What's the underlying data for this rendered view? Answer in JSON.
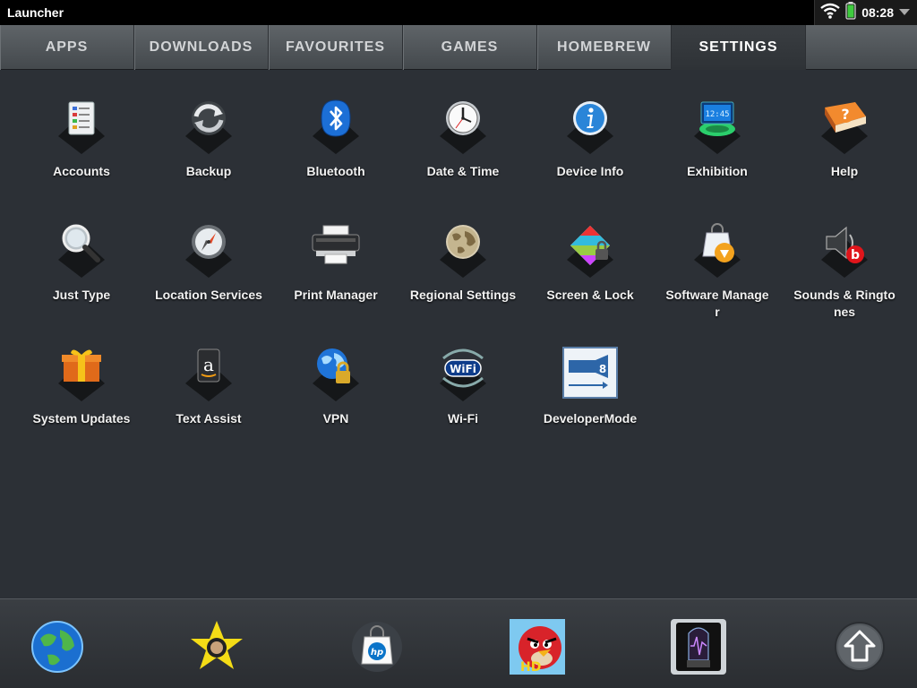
{
  "status_bar": {
    "app_title": "Launcher",
    "clock": "08:28",
    "wifi_icon": "wifi-icon",
    "battery_icon": "battery-icon",
    "menu_icon": "triangle-down-icon"
  },
  "tabs": [
    {
      "label": "APPS"
    },
    {
      "label": "DOWNLOADS"
    },
    {
      "label": "FAVOURITES"
    },
    {
      "label": "GAMES"
    },
    {
      "label": "HOMEBREW"
    },
    {
      "label": "SETTINGS",
      "active": true
    }
  ],
  "apps": [
    {
      "label": "Accounts",
      "icon": "accounts-icon"
    },
    {
      "label": "Backup",
      "icon": "backup-icon"
    },
    {
      "label": "Bluetooth",
      "icon": "bluetooth-icon"
    },
    {
      "label": "Date & Time",
      "icon": "clock-icon"
    },
    {
      "label": "Device Info",
      "icon": "info-icon"
    },
    {
      "label": "Exhibition",
      "icon": "exhibition-icon"
    },
    {
      "label": "Help",
      "icon": "help-book-icon"
    },
    {
      "label": "Just Type",
      "icon": "magnifier-icon"
    },
    {
      "label": "Location Services",
      "icon": "compass-icon"
    },
    {
      "label": "Print Manager",
      "icon": "printer-icon"
    },
    {
      "label": "Regional Settings",
      "icon": "globe-icon"
    },
    {
      "label": "Screen & Lock",
      "icon": "screen-lock-icon"
    },
    {
      "label": "Software Manager",
      "icon": "shopping-bag-icon"
    },
    {
      "label": "Sounds & Ringtones",
      "icon": "speaker-icon"
    },
    {
      "label": "System Updates",
      "icon": "gift-icon"
    },
    {
      "label": "Text Assist",
      "icon": "amazon-icon"
    },
    {
      "label": "VPN",
      "icon": "globe-lock-icon"
    },
    {
      "label": "Wi-Fi",
      "icon": "wifi-badge-icon"
    },
    {
      "label": "DeveloperMode",
      "icon": "developer-mode-icon"
    }
  ],
  "dock": [
    {
      "name": "browser-globe-icon"
    },
    {
      "name": "star-app-icon"
    },
    {
      "name": "hp-app-catalog-icon"
    },
    {
      "name": "angry-birds-hd-icon"
    },
    {
      "name": "vacuum-tube-icon"
    },
    {
      "name": "launcher-up-arrow-icon"
    }
  ],
  "colors": {
    "background": "#2c3036",
    "tab_bar": "#54595d",
    "active_tab": "#33373b",
    "status_bar": "#000000",
    "battery": "#3ecb3e"
  }
}
